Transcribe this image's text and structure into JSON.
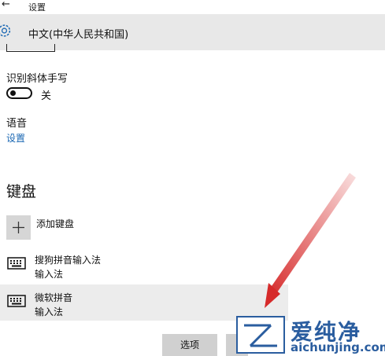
{
  "window": {
    "title": "设置",
    "back_glyph": "←"
  },
  "header": {
    "title": "中文(中华人民共和国)"
  },
  "handwriting": {
    "label": "识别斜体手写",
    "toggle_state": "关",
    "toggle_on": false
  },
  "speech": {
    "label": "语音",
    "link": "设置"
  },
  "keyboard": {
    "section_title": "键盘",
    "add_label": "添加键盘",
    "items": [
      {
        "name": "搜狗拼音输入法",
        "type": "输入法",
        "selected": false
      },
      {
        "name": "微软拼音",
        "type": "输入法",
        "selected": true
      }
    ]
  },
  "buttons": {
    "options": "选项"
  },
  "watermark": {
    "brand": "爱纯净",
    "url": "aichunjing.com"
  },
  "colors": {
    "link": "#1a67b3",
    "header_bg": "#e8e8e8",
    "arrow": "#d62a2a",
    "watermark": "#2a5d9f"
  }
}
